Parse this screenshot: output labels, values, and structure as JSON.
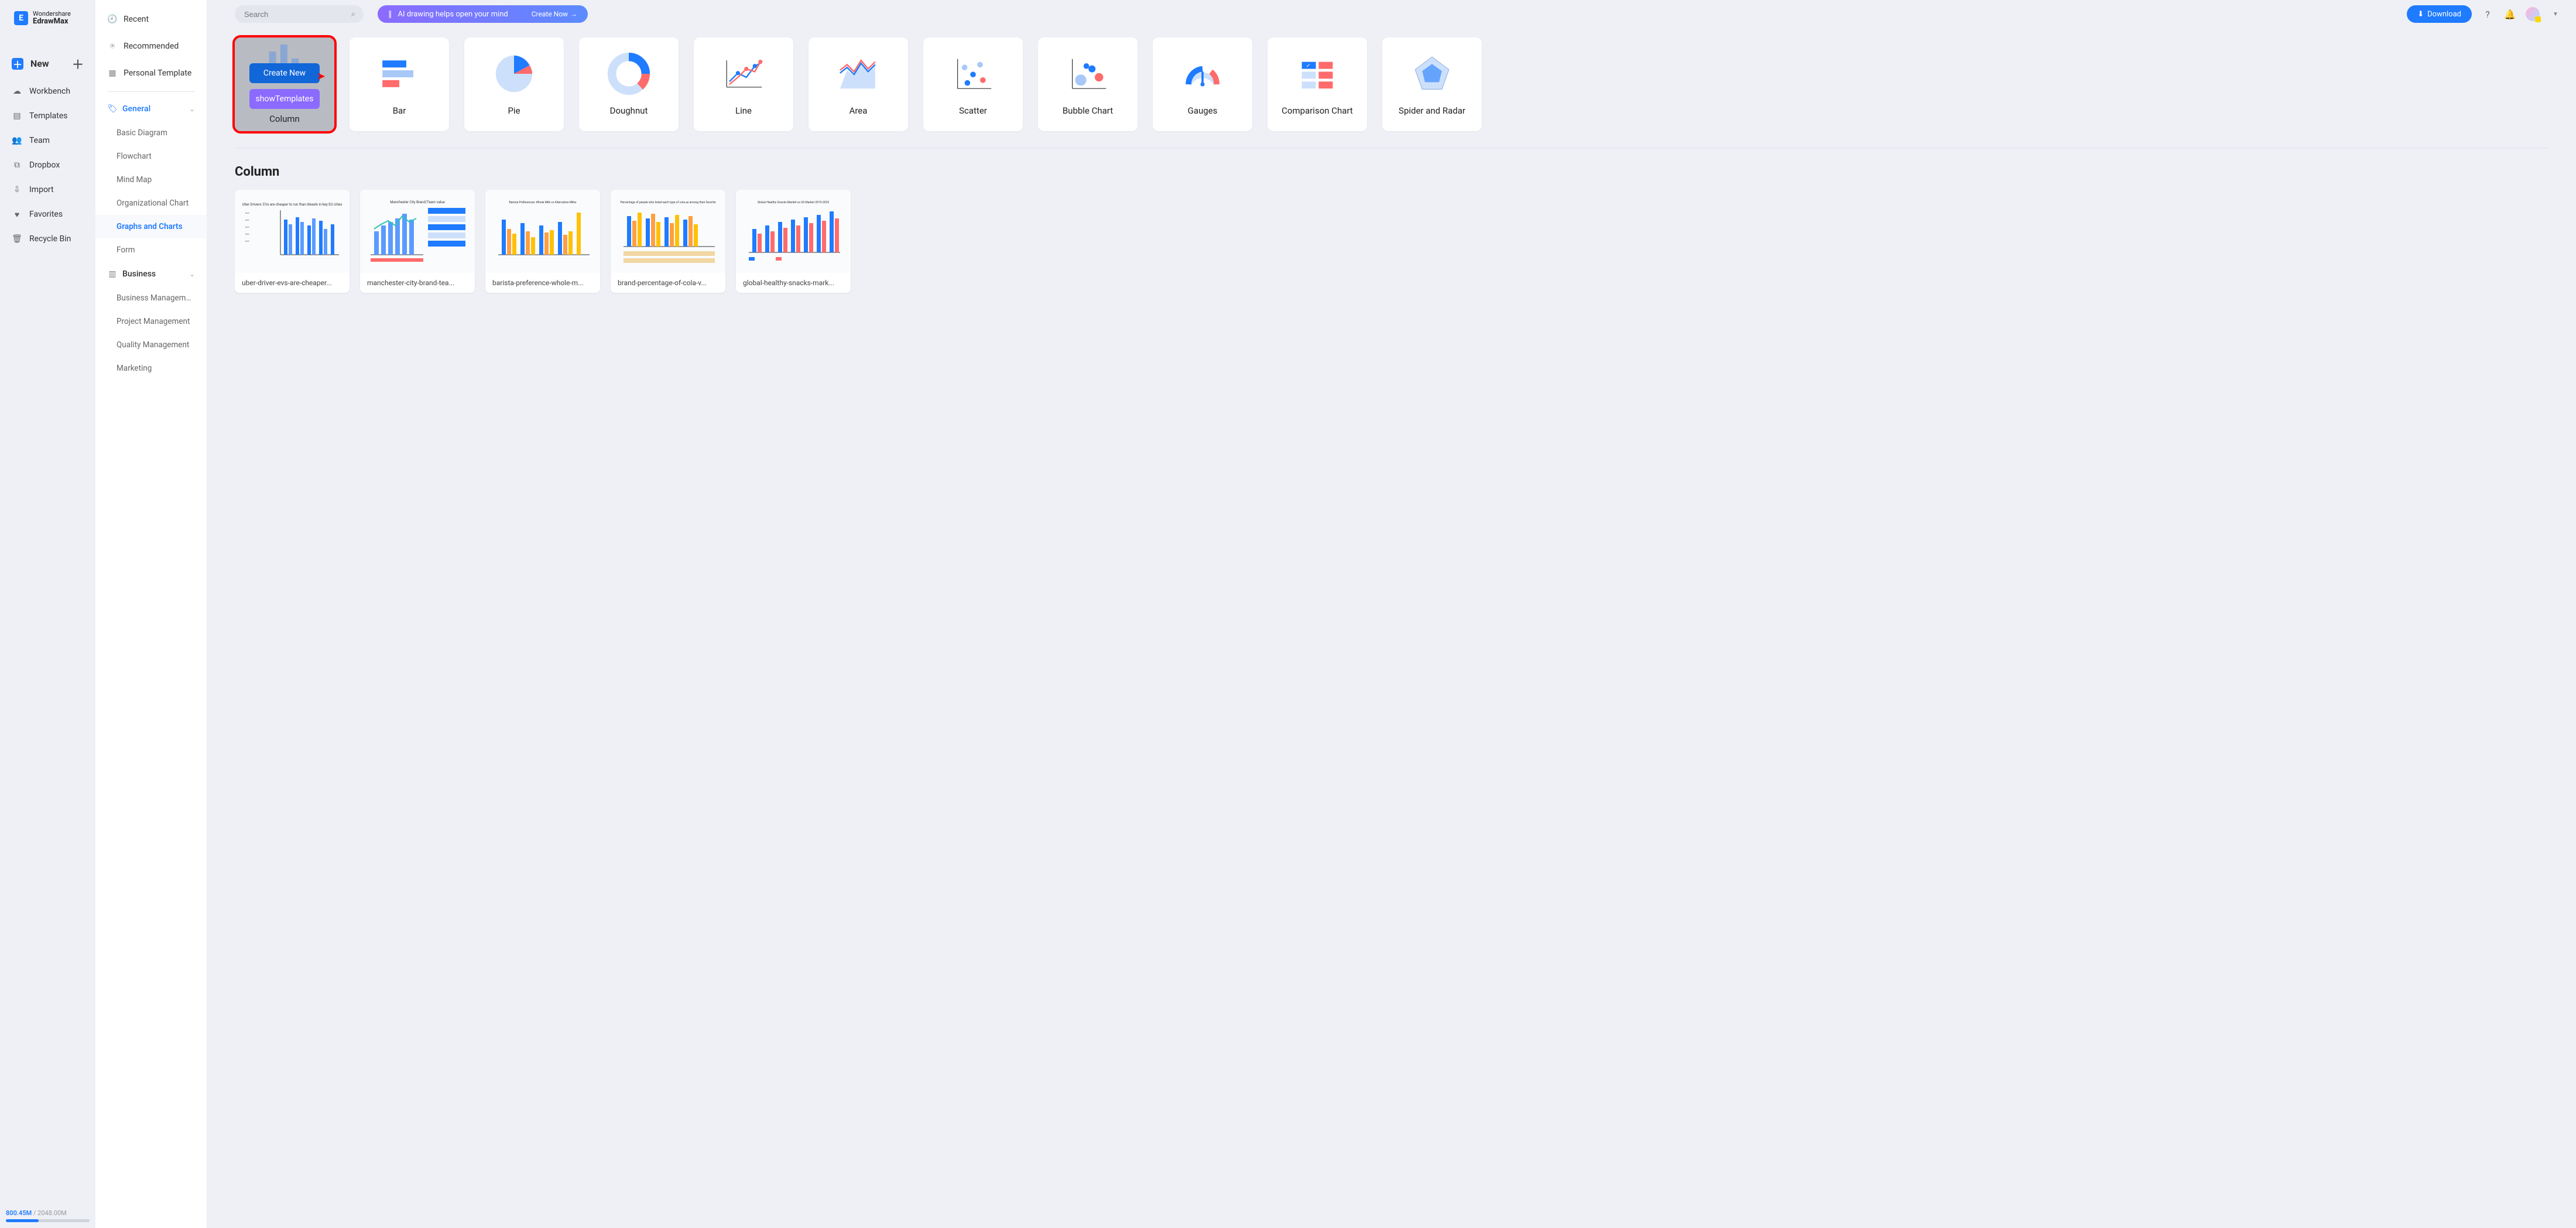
{
  "app": {
    "brand_top": "Wondershare",
    "brand_main": "EdrawMax"
  },
  "nav_left": {
    "new_label": "New",
    "items": [
      {
        "id": "workbench",
        "label": "Workbench"
      },
      {
        "id": "templates",
        "label": "Templates"
      },
      {
        "id": "team",
        "label": "Team"
      },
      {
        "id": "dropbox",
        "label": "Dropbox"
      },
      {
        "id": "import",
        "label": "Import"
      },
      {
        "id": "favorites",
        "label": "Favorites"
      },
      {
        "id": "recycle",
        "label": "Recycle Bin"
      }
    ]
  },
  "storage": {
    "used": "800.45M",
    "separator": " / ",
    "total": "2048.00M",
    "percent": 39
  },
  "nav_second": {
    "top": [
      {
        "id": "recent",
        "label": "Recent"
      },
      {
        "id": "recommended",
        "label": "Recommended"
      },
      {
        "id": "personal-template",
        "label": "Personal Template"
      }
    ],
    "groups": [
      {
        "id": "general",
        "label": "General",
        "active": true,
        "expanded": true,
        "children": [
          {
            "id": "basic-diagram",
            "label": "Basic Diagram"
          },
          {
            "id": "flowchart",
            "label": "Flowchart"
          },
          {
            "id": "mind-map",
            "label": "Mind Map"
          },
          {
            "id": "organizational-chart",
            "label": "Organizational Chart"
          },
          {
            "id": "graphs-charts",
            "label": "Graphs and Charts",
            "active": true
          },
          {
            "id": "form",
            "label": "Form"
          }
        ]
      },
      {
        "id": "business",
        "label": "Business",
        "expanded": true,
        "children": [
          {
            "id": "business-management",
            "label": "Business Management"
          },
          {
            "id": "project-management",
            "label": "Project Management"
          },
          {
            "id": "quality-management",
            "label": "Quality Management"
          },
          {
            "id": "marketing",
            "label": "Marketing"
          }
        ]
      }
    ]
  },
  "topbar": {
    "search_placeholder": "Search",
    "banner_text": "AI drawing helps open your mind",
    "banner_cta": "Create Now",
    "download_label": "Download"
  },
  "chart_types": {
    "row1": [
      {
        "id": "column",
        "label": "Column",
        "active": true
      },
      {
        "id": "bar",
        "label": "Bar"
      },
      {
        "id": "pie",
        "label": "Pie"
      },
      {
        "id": "doughnut",
        "label": "Doughnut"
      },
      {
        "id": "line",
        "label": "Line"
      },
      {
        "id": "area",
        "label": "Area"
      }
    ],
    "row2": [
      {
        "id": "scatter",
        "label": "Scatter"
      },
      {
        "id": "bubble",
        "label": "Bubble Chart"
      },
      {
        "id": "gauges",
        "label": "Gauges"
      },
      {
        "id": "comparison",
        "label": "Comparison Chart"
      },
      {
        "id": "spider",
        "label": "Spider and Radar"
      }
    ],
    "overlay": {
      "create_new": "Create New",
      "show_templates": "showTemplates"
    }
  },
  "section": {
    "title": "Column",
    "templates": [
      {
        "id": "t1",
        "label": "uber-driver-evs-are-cheaper..."
      },
      {
        "id": "t2",
        "label": "manchester-city-brand-tea..."
      },
      {
        "id": "t3",
        "label": "barista-preference-whole-m..."
      },
      {
        "id": "t4",
        "label": "brand-percentage-of-cola-v..."
      },
      {
        "id": "t5",
        "label": "global-healthy-snacks-mark..."
      }
    ]
  }
}
